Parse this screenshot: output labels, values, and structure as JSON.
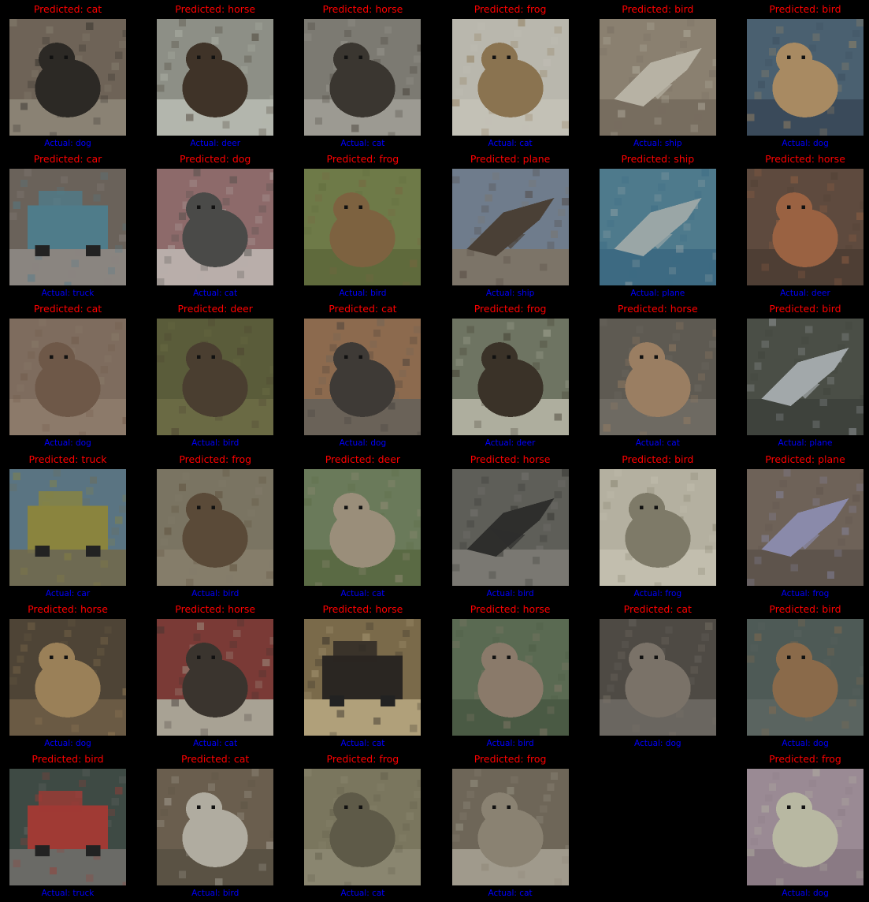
{
  "colors": {
    "background": "#000000",
    "predicted_label": "#ff0000",
    "actual_label": "#0000ff"
  },
  "samples": [
    {
      "predicted": "Predicted: cat",
      "actual": "Actual: dog",
      "bg": "#6e6357",
      "fg": "#2c2925",
      "ground": "#8a8274",
      "subject": "blob"
    },
    {
      "predicted": "Predicted: horse",
      "actual": "Actual: deer",
      "bg": "#8d8f86",
      "fg": "#3f3328",
      "ground": "#b3b6ad",
      "subject": "blob"
    },
    {
      "predicted": "Predicted: horse",
      "actual": "Actual: cat",
      "bg": "#7c7a72",
      "fg": "#3a3630",
      "ground": "#9c9a92",
      "subject": "blob"
    },
    {
      "predicted": "Predicted: frog",
      "actual": "Actual: cat",
      "bg": "#b9b7ad",
      "fg": "#8a7350",
      "ground": "#c3c1b6",
      "subject": "blob"
    },
    {
      "predicted": "Predicted: bird",
      "actual": "Actual: ship",
      "bg": "#8a8070",
      "fg": "#b7b2a4",
      "ground": "#776d5f",
      "subject": "diag"
    },
    {
      "predicted": "Predicted: bird",
      "actual": "Actual: dog",
      "bg": "#4a6070",
      "fg": "#a88a62",
      "ground": "#3a4a5a",
      "subject": "blob"
    },
    {
      "predicted": "Predicted: car",
      "actual": "Actual: truck",
      "bg": "#6a625a",
      "fg": "#4f7c8a",
      "ground": "#8a8580",
      "subject": "rect"
    },
    {
      "predicted": "Predicted: dog",
      "actual": "Actual: cat",
      "bg": "#8d6a6a",
      "fg": "#4a4a48",
      "ground": "#b9aeaa",
      "subject": "blob"
    },
    {
      "predicted": "Predicted: frog",
      "actual": "Actual: bird",
      "bg": "#6e7a48",
      "fg": "#7d6240",
      "ground": "#5f6a3c",
      "subject": "blob"
    },
    {
      "predicted": "Predicted: plane",
      "actual": "Actual: ship",
      "bg": "#6f7c8c",
      "fg": "#4a4036",
      "ground": "#7c7468",
      "subject": "diag"
    },
    {
      "predicted": "Predicted: ship",
      "actual": "Actual: plane",
      "bg": "#4e7a8c",
      "fg": "#9aa6a6",
      "ground": "#3d6a82",
      "subject": "diag"
    },
    {
      "predicted": "Predicted: horse",
      "actual": "Actual: deer",
      "bg": "#5e4a3e",
      "fg": "#9a6242",
      "ground": "#4e3e34",
      "subject": "blob"
    },
    {
      "predicted": "Predicted: cat",
      "actual": "Actual: dog",
      "bg": "#7e6c5e",
      "fg": "#6e5848",
      "ground": "#8c7a6a",
      "subject": "blob"
    },
    {
      "predicted": "Predicted: deer",
      "actual": "Actual: bird",
      "bg": "#5a5c3a",
      "fg": "#4a3e30",
      "ground": "#6a6a44",
      "subject": "blob"
    },
    {
      "predicted": "Predicted: cat",
      "actual": "Actual: dog",
      "bg": "#8c6a4e",
      "fg": "#3e3a36",
      "ground": "#6a6258",
      "subject": "blob"
    },
    {
      "predicted": "Predicted: frog",
      "actual": "Actual: deer",
      "bg": "#6e7462",
      "fg": "#3a3228",
      "ground": "#aeae9e",
      "subject": "blob"
    },
    {
      "predicted": "Predicted: horse",
      "actual": "Actual: cat",
      "bg": "#5e5a52",
      "fg": "#9a7e62",
      "ground": "#6e6a62",
      "subject": "blob"
    },
    {
      "predicted": "Predicted: bird",
      "actual": "Actual: plane",
      "bg": "#4a4e46",
      "fg": "#a2a8aa",
      "ground": "#3e423c",
      "subject": "diag"
    },
    {
      "predicted": "Predicted: truck",
      "actual": "Actual: car",
      "bg": "#5a7482",
      "fg": "#8a843e",
      "ground": "#6e6a52",
      "subject": "rect"
    },
    {
      "predicted": "Predicted: frog",
      "actual": "Actual: bird",
      "bg": "#7a7462",
      "fg": "#5a4a38",
      "ground": "#857d6a",
      "subject": "blob"
    },
    {
      "predicted": "Predicted: deer",
      "actual": "Actual: cat",
      "bg": "#6a7a5a",
      "fg": "#9a8e7a",
      "ground": "#5a6a44",
      "subject": "blob"
    },
    {
      "predicted": "Predicted: horse",
      "actual": "Actual: bird",
      "bg": "#5e5e58",
      "fg": "#2e2e2c",
      "ground": "#7a7872",
      "subject": "diag"
    },
    {
      "predicted": "Predicted: bird",
      "actual": "Actual: frog",
      "bg": "#b4b0a0",
      "fg": "#7e7a68",
      "ground": "#c2beae",
      "subject": "blob"
    },
    {
      "predicted": "Predicted: plane",
      "actual": "Actual: frog",
      "bg": "#6e6258",
      "fg": "#8a8aaa",
      "ground": "#5e544c",
      "subject": "diag"
    },
    {
      "predicted": "Predicted: horse",
      "actual": "Actual: dog",
      "bg": "#4e4436",
      "fg": "#9a8058",
      "ground": "#6a5a44",
      "subject": "blob"
    },
    {
      "predicted": "Predicted: horse",
      "actual": "Actual: cat",
      "bg": "#7a3a36",
      "fg": "#3a342e",
      "ground": "#a8a294",
      "subject": "blob"
    },
    {
      "predicted": "Predicted: horse",
      "actual": "Actual: cat",
      "bg": "#7a6a4a",
      "fg": "#2a2622",
      "ground": "#b0a07a",
      "subject": "rect"
    },
    {
      "predicted": "Predicted: horse",
      "actual": "Actual: bird",
      "bg": "#5a6a52",
      "fg": "#8a7a6a",
      "ground": "#4a5a44",
      "subject": "blob"
    },
    {
      "predicted": "Predicted: cat",
      "actual": "Actual: dog",
      "bg": "#4e4a44",
      "fg": "#7a7268",
      "ground": "#6a6660",
      "subject": "blob"
    },
    {
      "predicted": "Predicted: bird",
      "actual": "Actual: dog",
      "bg": "#4e5a56",
      "fg": "#8a6a4a",
      "ground": "#5a6460",
      "subject": "blob"
    },
    {
      "predicted": "Predicted: bird",
      "actual": "Actual: truck",
      "bg": "#3e4a44",
      "fg": "#a03a34",
      "ground": "#6a6a66",
      "subject": "rect"
    },
    {
      "predicted": "Predicted: cat",
      "actual": "Actual: bird",
      "bg": "#6a5e4e",
      "fg": "#b0aca0",
      "ground": "#5a5244",
      "subject": "blob"
    },
    {
      "predicted": "Predicted: frog",
      "actual": "Actual: cat",
      "bg": "#7a765e",
      "fg": "#5e5a48",
      "ground": "#8a8670",
      "subject": "blob"
    },
    {
      "predicted": "Predicted: frog",
      "actual": "Actual: cat",
      "bg": "#6e6658",
      "fg": "#8a8272",
      "ground": "#a09a8c",
      "subject": "blob"
    },
    null,
    {
      "predicted": "Predicted: frog",
      "actual": "Actual: dog",
      "bg": "#9a8a94",
      "fg": "#b8b8a2",
      "ground": "#8a7a84",
      "subject": "blob"
    }
  ]
}
